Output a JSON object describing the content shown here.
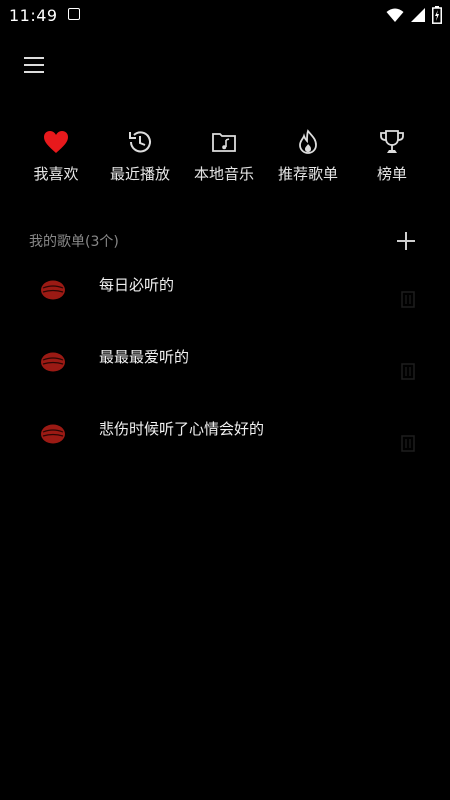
{
  "status_bar": {
    "time": "11:49"
  },
  "shortcuts": [
    {
      "label": "我喜欢"
    },
    {
      "label": "最近播放"
    },
    {
      "label": "本地音乐"
    },
    {
      "label": "推荐歌单"
    },
    {
      "label": "榜单"
    }
  ],
  "playlists_section": {
    "title": "我的歌单(3个)",
    "items": [
      {
        "name": "每日必听的"
      },
      {
        "name": "最最最爱听的"
      },
      {
        "name": "悲伤时候听了心情会好的"
      }
    ]
  },
  "colors": {
    "background": "#000000",
    "accent_red": "#e8191c",
    "cover_red": "#9b1a14"
  }
}
